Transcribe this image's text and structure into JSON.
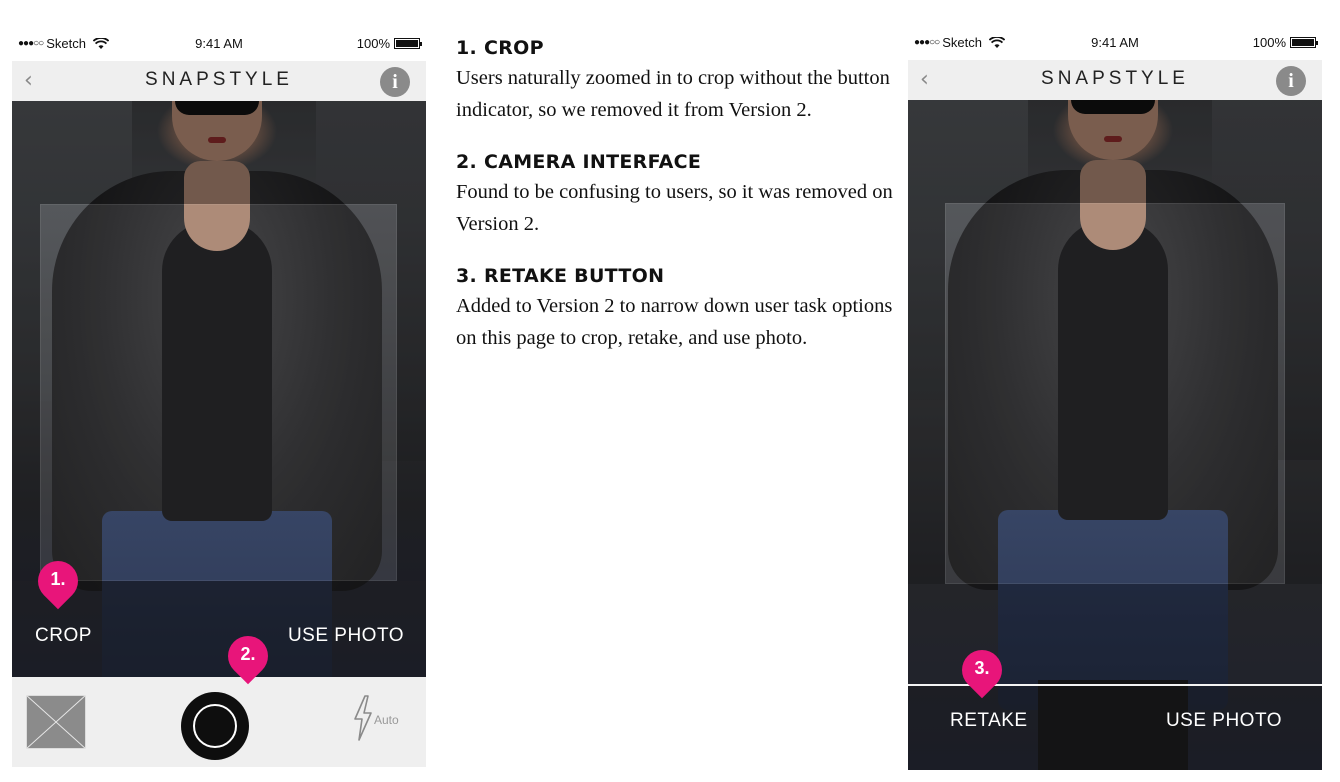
{
  "status_bar": {
    "carrier": "Sketch",
    "time": "9:41 AM",
    "battery": "100%"
  },
  "app": {
    "title": "SNAPSTYLE",
    "back_icon": "chevron-left-icon",
    "info_icon": "info-icon",
    "info_glyph": "i"
  },
  "version1": {
    "crop_label": "CROP",
    "use_photo_label": "USE PHOTO",
    "pin_crop": "1.",
    "pin_camera": "2.",
    "flash_label": "Auto"
  },
  "version2": {
    "retake_label": "RETAKE",
    "use_photo_label": "USE PHOTO",
    "pin_retake": "3."
  },
  "notes": [
    {
      "heading": "1. CROP",
      "body": "Users naturally zoomed in to crop without the button indicator, so we removed it from Version 2."
    },
    {
      "heading": "2. CAMERA INTERFACE",
      "body": "Found to be confusing to users, so it was removed on Version 2."
    },
    {
      "heading": "3. RETAKE BUTTON",
      "body": "Added to Version 2 to narrow down user task options on this page to crop, retake, and use photo."
    }
  ],
  "colors": {
    "pin": "#e8157a",
    "nav_bg": "#efefef",
    "info_bg": "#8a8a8a"
  }
}
